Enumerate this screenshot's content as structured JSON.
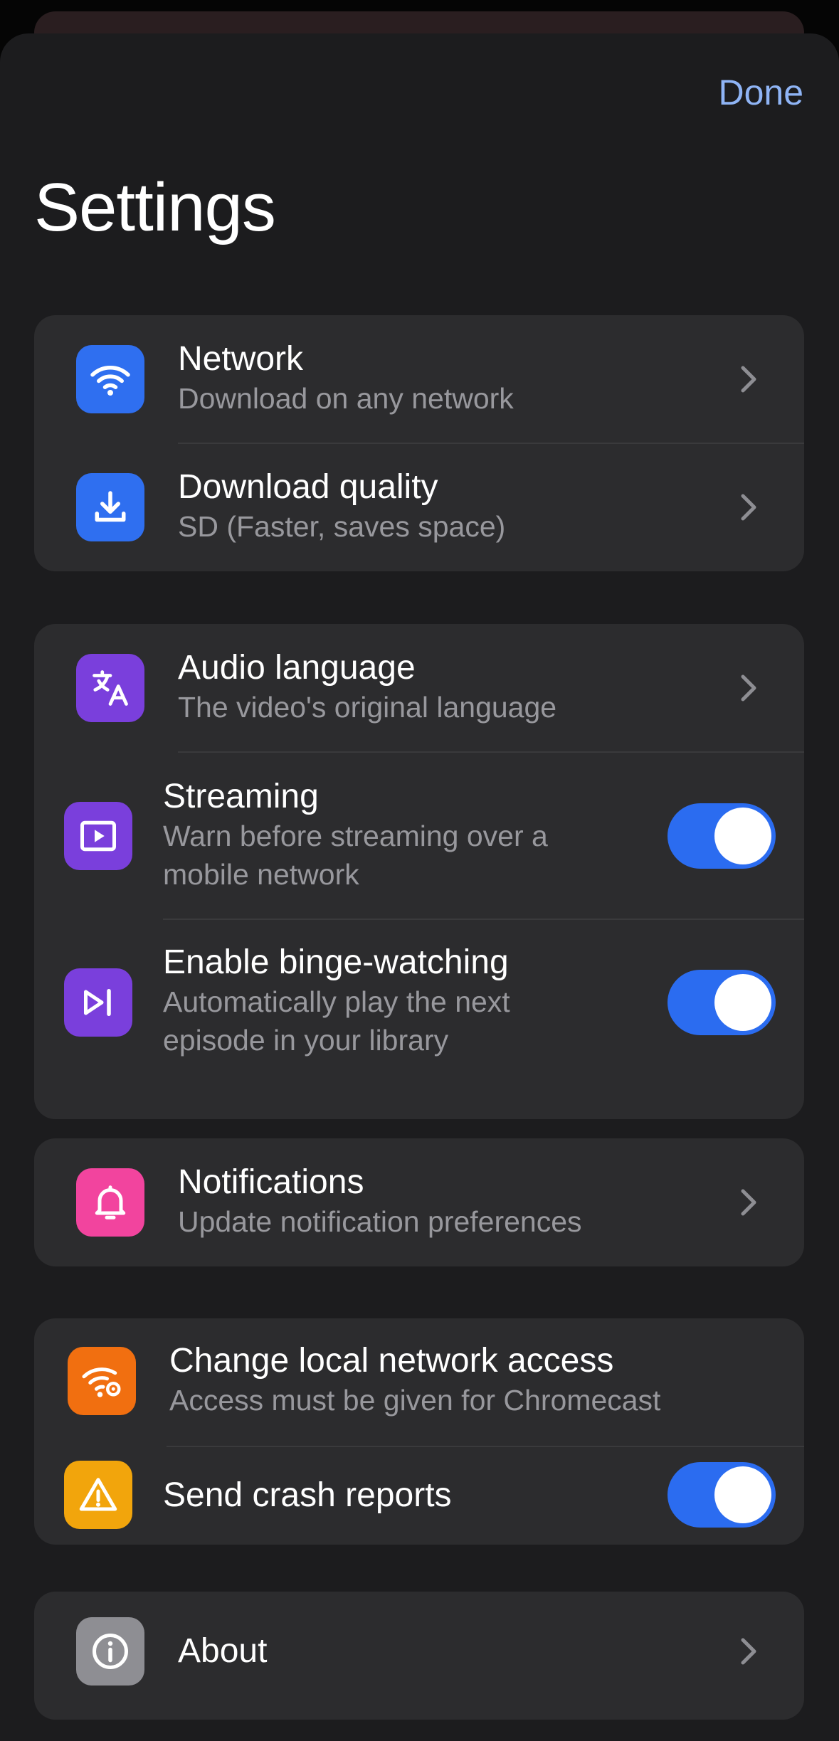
{
  "header": {
    "done_label": "Done",
    "title": "Settings"
  },
  "colors": {
    "accent": "#2b6cf0",
    "done_link": "#8fb4f5",
    "blue_icon": "#2f6ff0",
    "purple_icon": "#7a3fdc",
    "pink_icon": "#f2449e",
    "orange_icon": "#f16f10",
    "yellow_icon": "#f2a50c",
    "gray_icon": "#8e8e93"
  },
  "groups": [
    {
      "rows": [
        {
          "title": "Network",
          "subtitle": "Download on any network",
          "icon": "wifi-icon",
          "control": "chevron"
        },
        {
          "title": "Download quality",
          "subtitle": "SD (Faster, saves space)",
          "icon": "download-icon",
          "control": "chevron"
        }
      ]
    },
    {
      "rows": [
        {
          "title": "Audio language",
          "subtitle": "The video's original language",
          "icon": "translate-icon",
          "control": "chevron"
        },
        {
          "title": "Streaming",
          "subtitle": "Warn before streaming over a mobile network",
          "icon": "play-icon",
          "control": "toggle",
          "value": true
        },
        {
          "title": "Enable binge-watching",
          "subtitle": "Automatically play the next episode in your library",
          "icon": "skip-next-icon",
          "control": "toggle",
          "value": true
        }
      ]
    },
    {
      "rows": [
        {
          "title": "Notifications",
          "subtitle": "Update notification preferences",
          "icon": "bell-icon",
          "control": "chevron"
        }
      ]
    },
    {
      "rows": [
        {
          "title": "Change local network access",
          "subtitle": "Access must be given for Chromecast",
          "icon": "wifi-settings-icon",
          "control": "none"
        },
        {
          "title": "Send crash reports",
          "icon": "warning-icon",
          "control": "toggle",
          "value": true
        }
      ]
    },
    {
      "rows": [
        {
          "title": "About",
          "icon": "info-icon",
          "control": "chevron"
        }
      ]
    }
  ]
}
